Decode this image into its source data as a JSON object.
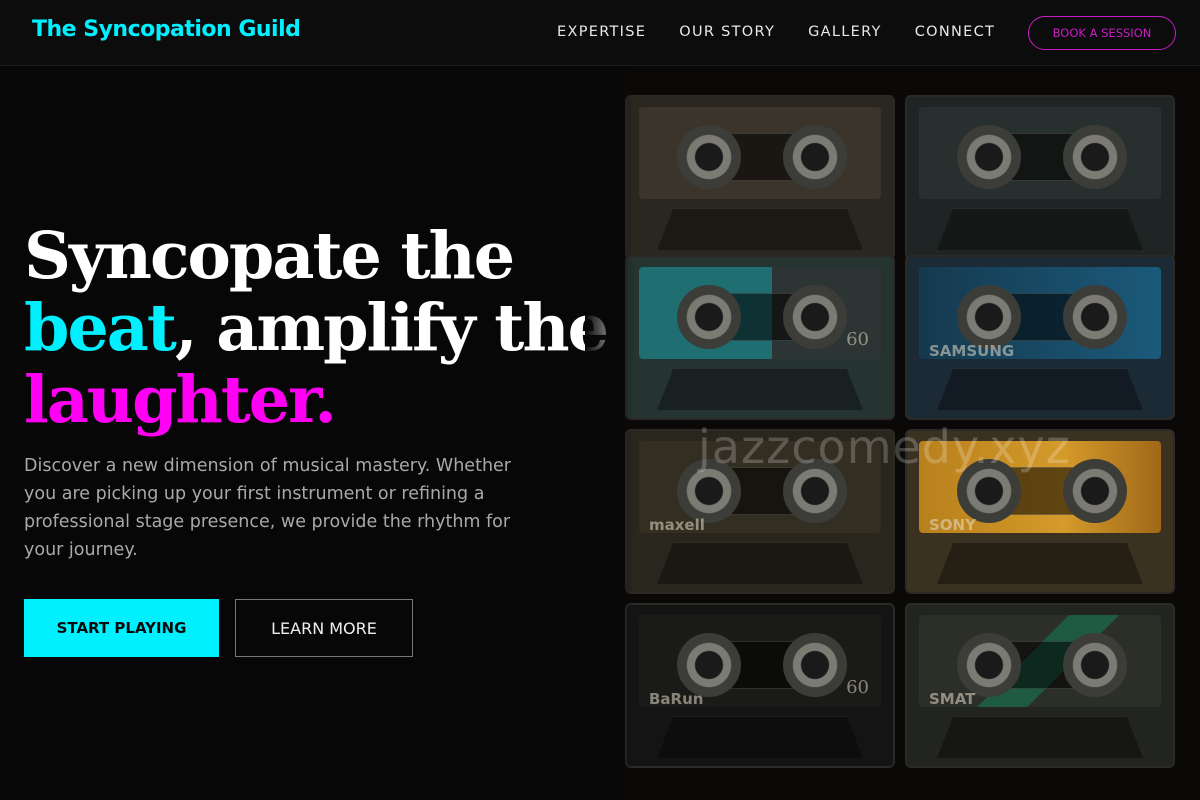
{
  "nav": {
    "brand": "The Syncopation Guild",
    "links": [
      "EXPERTISE",
      "OUR STORY",
      "GALLERY",
      "CONNECT"
    ],
    "cta": "BOOK A SESSION"
  },
  "hero": {
    "headline": {
      "part1": "Syncopate the",
      "accent1": "beat",
      "part2": ", amplify the",
      "accent2": "laughter."
    },
    "subtext": "Discover a new dimension of musical mastery. Whether you are picking up your first instrument or refining a professional stage presence, we provide the rhythm for your journey.",
    "primary_button": "START PLAYING",
    "secondary_button": "LEARN MORE"
  },
  "image": {
    "watermark": "jazzcomedy.xyz",
    "tapes": [
      {
        "brand": "",
        "number": ""
      },
      {
        "brand": "",
        "number": ""
      },
      {
        "brand": "",
        "number": "60"
      },
      {
        "brand": "SAMSUNG",
        "number": ""
      },
      {
        "brand": "maxell",
        "number": ""
      },
      {
        "brand": "SONY",
        "number": ""
      },
      {
        "brand": "BaRun",
        "number": "60"
      },
      {
        "brand": "SMAT",
        "number": ""
      }
    ]
  },
  "colors": {
    "cyan": "#00f0ff",
    "magenta": "#ff00f5",
    "cta_border": "#c81ec8"
  }
}
